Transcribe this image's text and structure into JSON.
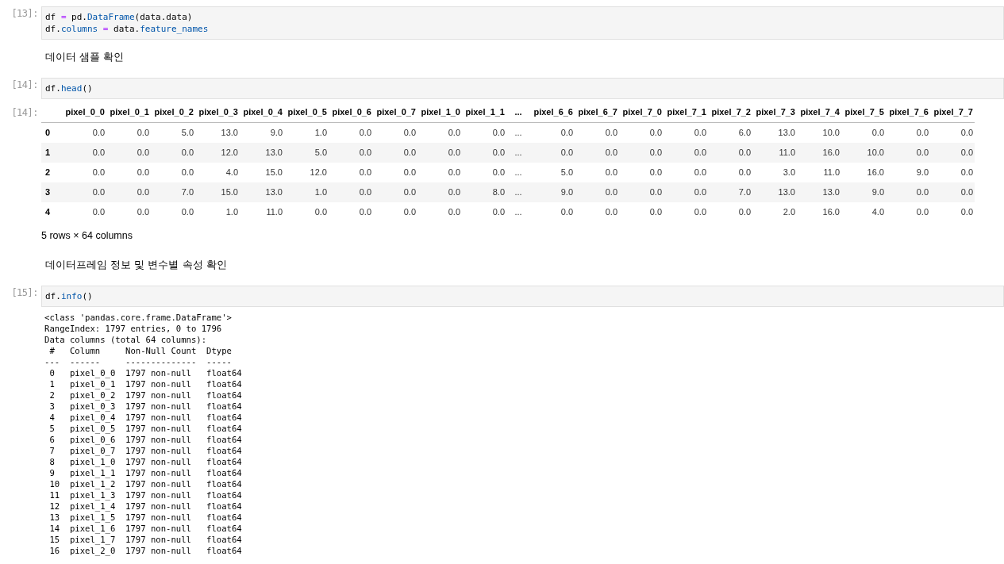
{
  "cells": [
    {
      "kind": "code",
      "prompt": "[13]:",
      "lines": [
        [
          {
            "text": "df ",
            "kind": "var"
          },
          {
            "text": "=",
            "kind": "op"
          },
          {
            "text": " pd.",
            "kind": "var"
          },
          {
            "text": "DataFrame",
            "kind": "prop"
          },
          {
            "text": "(data.data)",
            "kind": "var"
          }
        ],
        [
          {
            "text": "df.",
            "kind": "var"
          },
          {
            "text": "columns",
            "kind": "prop"
          },
          {
            "text": " = ",
            "kind": "op"
          },
          {
            "text": "data.",
            "kind": "var"
          },
          {
            "text": "feature_names",
            "kind": "prop"
          }
        ]
      ]
    },
    {
      "kind": "markdown",
      "text": "데이터 샘플 확인"
    },
    {
      "kind": "code",
      "prompt": "[14]:",
      "lines": [
        [
          {
            "text": "df.",
            "kind": "var"
          },
          {
            "text": "head",
            "kind": "prop"
          },
          {
            "text": "()",
            "kind": "var"
          }
        ]
      ]
    },
    {
      "kind": "table_output",
      "prompt": "[14]:",
      "columns": [
        "pixel_0_0",
        "pixel_0_1",
        "pixel_0_2",
        "pixel_0_3",
        "pixel_0_4",
        "pixel_0_5",
        "pixel_0_6",
        "pixel_0_7",
        "pixel_1_0",
        "pixel_1_1",
        "...",
        "pixel_6_6",
        "pixel_6_7",
        "pixel_7_0",
        "pixel_7_1",
        "pixel_7_2",
        "pixel_7_3",
        "pixel_7_4",
        "pixel_7_5",
        "pixel_7_6",
        "pixel_7_7"
      ],
      "rows": [
        {
          "index": "0",
          "cells": [
            "0.0",
            "0.0",
            "5.0",
            "13.0",
            "9.0",
            "1.0",
            "0.0",
            "0.0",
            "0.0",
            "0.0",
            "...",
            "0.0",
            "0.0",
            "0.0",
            "0.0",
            "6.0",
            "13.0",
            "10.0",
            "0.0",
            "0.0",
            "0.0"
          ]
        },
        {
          "index": "1",
          "cells": [
            "0.0",
            "0.0",
            "0.0",
            "12.0",
            "13.0",
            "5.0",
            "0.0",
            "0.0",
            "0.0",
            "0.0",
            "...",
            "0.0",
            "0.0",
            "0.0",
            "0.0",
            "0.0",
            "11.0",
            "16.0",
            "10.0",
            "0.0",
            "0.0"
          ]
        },
        {
          "index": "2",
          "cells": [
            "0.0",
            "0.0",
            "0.0",
            "4.0",
            "15.0",
            "12.0",
            "0.0",
            "0.0",
            "0.0",
            "0.0",
            "...",
            "5.0",
            "0.0",
            "0.0",
            "0.0",
            "0.0",
            "3.0",
            "11.0",
            "16.0",
            "9.0",
            "0.0"
          ]
        },
        {
          "index": "3",
          "cells": [
            "0.0",
            "0.0",
            "7.0",
            "15.0",
            "13.0",
            "1.0",
            "0.0",
            "0.0",
            "0.0",
            "8.0",
            "...",
            "9.0",
            "0.0",
            "0.0",
            "0.0",
            "7.0",
            "13.0",
            "13.0",
            "9.0",
            "0.0",
            "0.0"
          ]
        },
        {
          "index": "4",
          "cells": [
            "0.0",
            "0.0",
            "0.0",
            "1.0",
            "11.0",
            "0.0",
            "0.0",
            "0.0",
            "0.0",
            "0.0",
            "...",
            "0.0",
            "0.0",
            "0.0",
            "0.0",
            "0.0",
            "2.0",
            "16.0",
            "4.0",
            "0.0",
            "0.0"
          ]
        }
      ],
      "shape": "5 rows × 64 columns"
    },
    {
      "kind": "markdown",
      "text": "데이터프레임 정보 및 변수별 속성 확인"
    },
    {
      "kind": "code",
      "prompt": "[15]:",
      "lines": [
        [
          {
            "text": "df.",
            "kind": "var"
          },
          {
            "text": "info",
            "kind": "prop"
          },
          {
            "text": "()",
            "kind": "var"
          }
        ]
      ]
    },
    {
      "kind": "text_output",
      "lines": [
        "<class 'pandas.core.frame.DataFrame'>",
        "RangeIndex: 1797 entries, 0 to 1796",
        "Data columns (total 64 columns):",
        " #   Column     Non-Null Count  Dtype  ",
        "---  ------     --------------  -----  ",
        " 0   pixel_0_0  1797 non-null   float64",
        " 1   pixel_0_1  1797 non-null   float64",
        " 2   pixel_0_2  1797 non-null   float64",
        " 3   pixel_0_3  1797 non-null   float64",
        " 4   pixel_0_4  1797 non-null   float64",
        " 5   pixel_0_5  1797 non-null   float64",
        " 6   pixel_0_6  1797 non-null   float64",
        " 7   pixel_0_7  1797 non-null   float64",
        " 8   pixel_1_0  1797 non-null   float64",
        " 9   pixel_1_1  1797 non-null   float64",
        " 10  pixel_1_2  1797 non-null   float64",
        " 11  pixel_1_3  1797 non-null   float64",
        " 12  pixel_1_4  1797 non-null   float64",
        " 13  pixel_1_5  1797 non-null   float64",
        " 14  pixel_1_6  1797 non-null   float64",
        " 15  pixel_1_7  1797 non-null   float64",
        " 16  pixel_2_0  1797 non-null   float64"
      ]
    }
  ]
}
